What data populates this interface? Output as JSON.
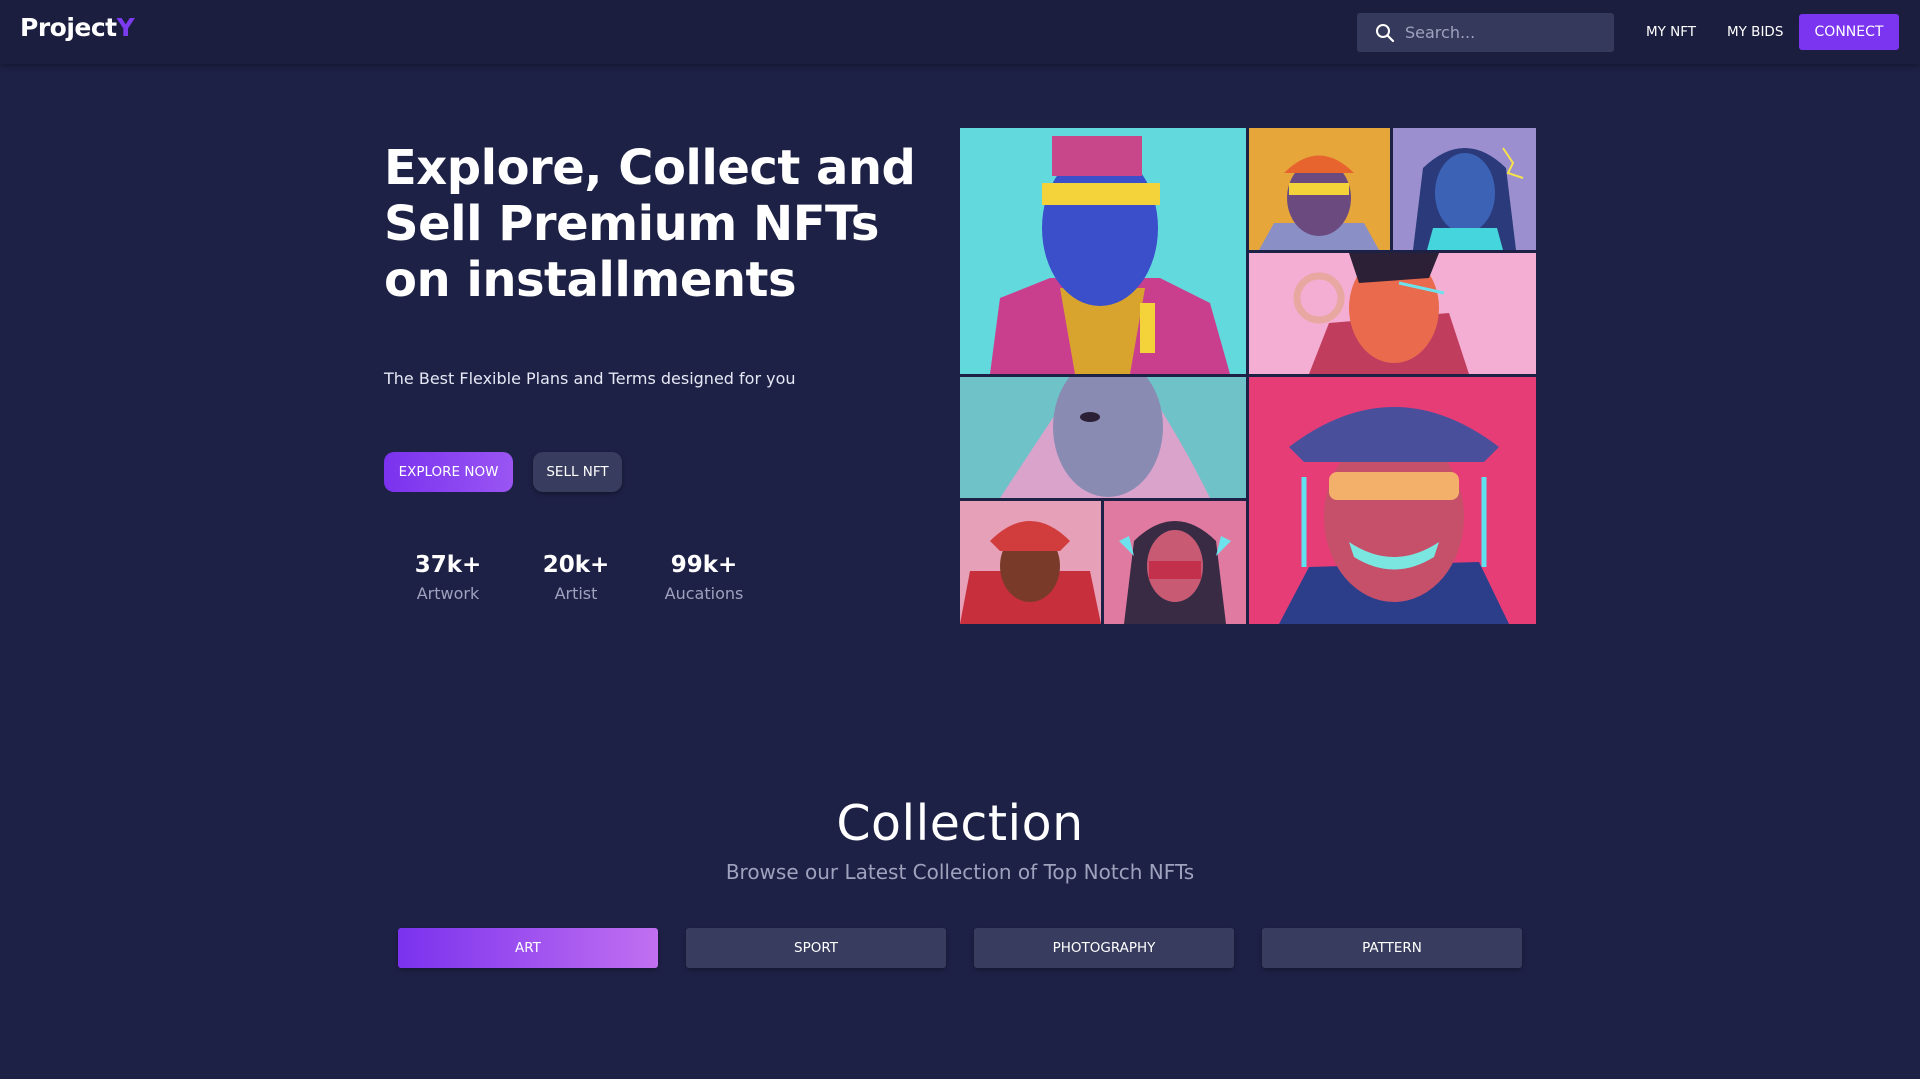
{
  "navbar": {
    "logo_main": "Project",
    "logo_accent": "Y",
    "search_placeholder": "Search...",
    "search_icon": "search-icon",
    "links": [
      "MY NFT",
      "MY BIDS"
    ],
    "connect_label": "CONNECT"
  },
  "hero": {
    "title": "Explore, Collect and Sell Premium NFTs on installments",
    "subtitle": "The Best Flexible Plans and Terms designed for you",
    "explore_label": "EXPLORE NOW",
    "sell_label": "SELL NFT",
    "stats": [
      {
        "value": "37k+",
        "label": "Artwork"
      },
      {
        "value": "20k+",
        "label": "Artist"
      },
      {
        "value": "99k+",
        "label": "Aucations"
      }
    ]
  },
  "collection": {
    "title": "Collection",
    "subtitle": "Browse our Latest Collection of Top Notch NFTs",
    "tabs": [
      "ART",
      "SPORT",
      "PHOTOGRAPHY",
      "PATTERN"
    ],
    "active_tab": "ART"
  },
  "colors": {
    "background": "#1e2146",
    "navbar": "#1b1e3f",
    "accent": "#7b35f0",
    "secondary_button": "#383c5e",
    "muted_text": "#9ea2bd"
  }
}
